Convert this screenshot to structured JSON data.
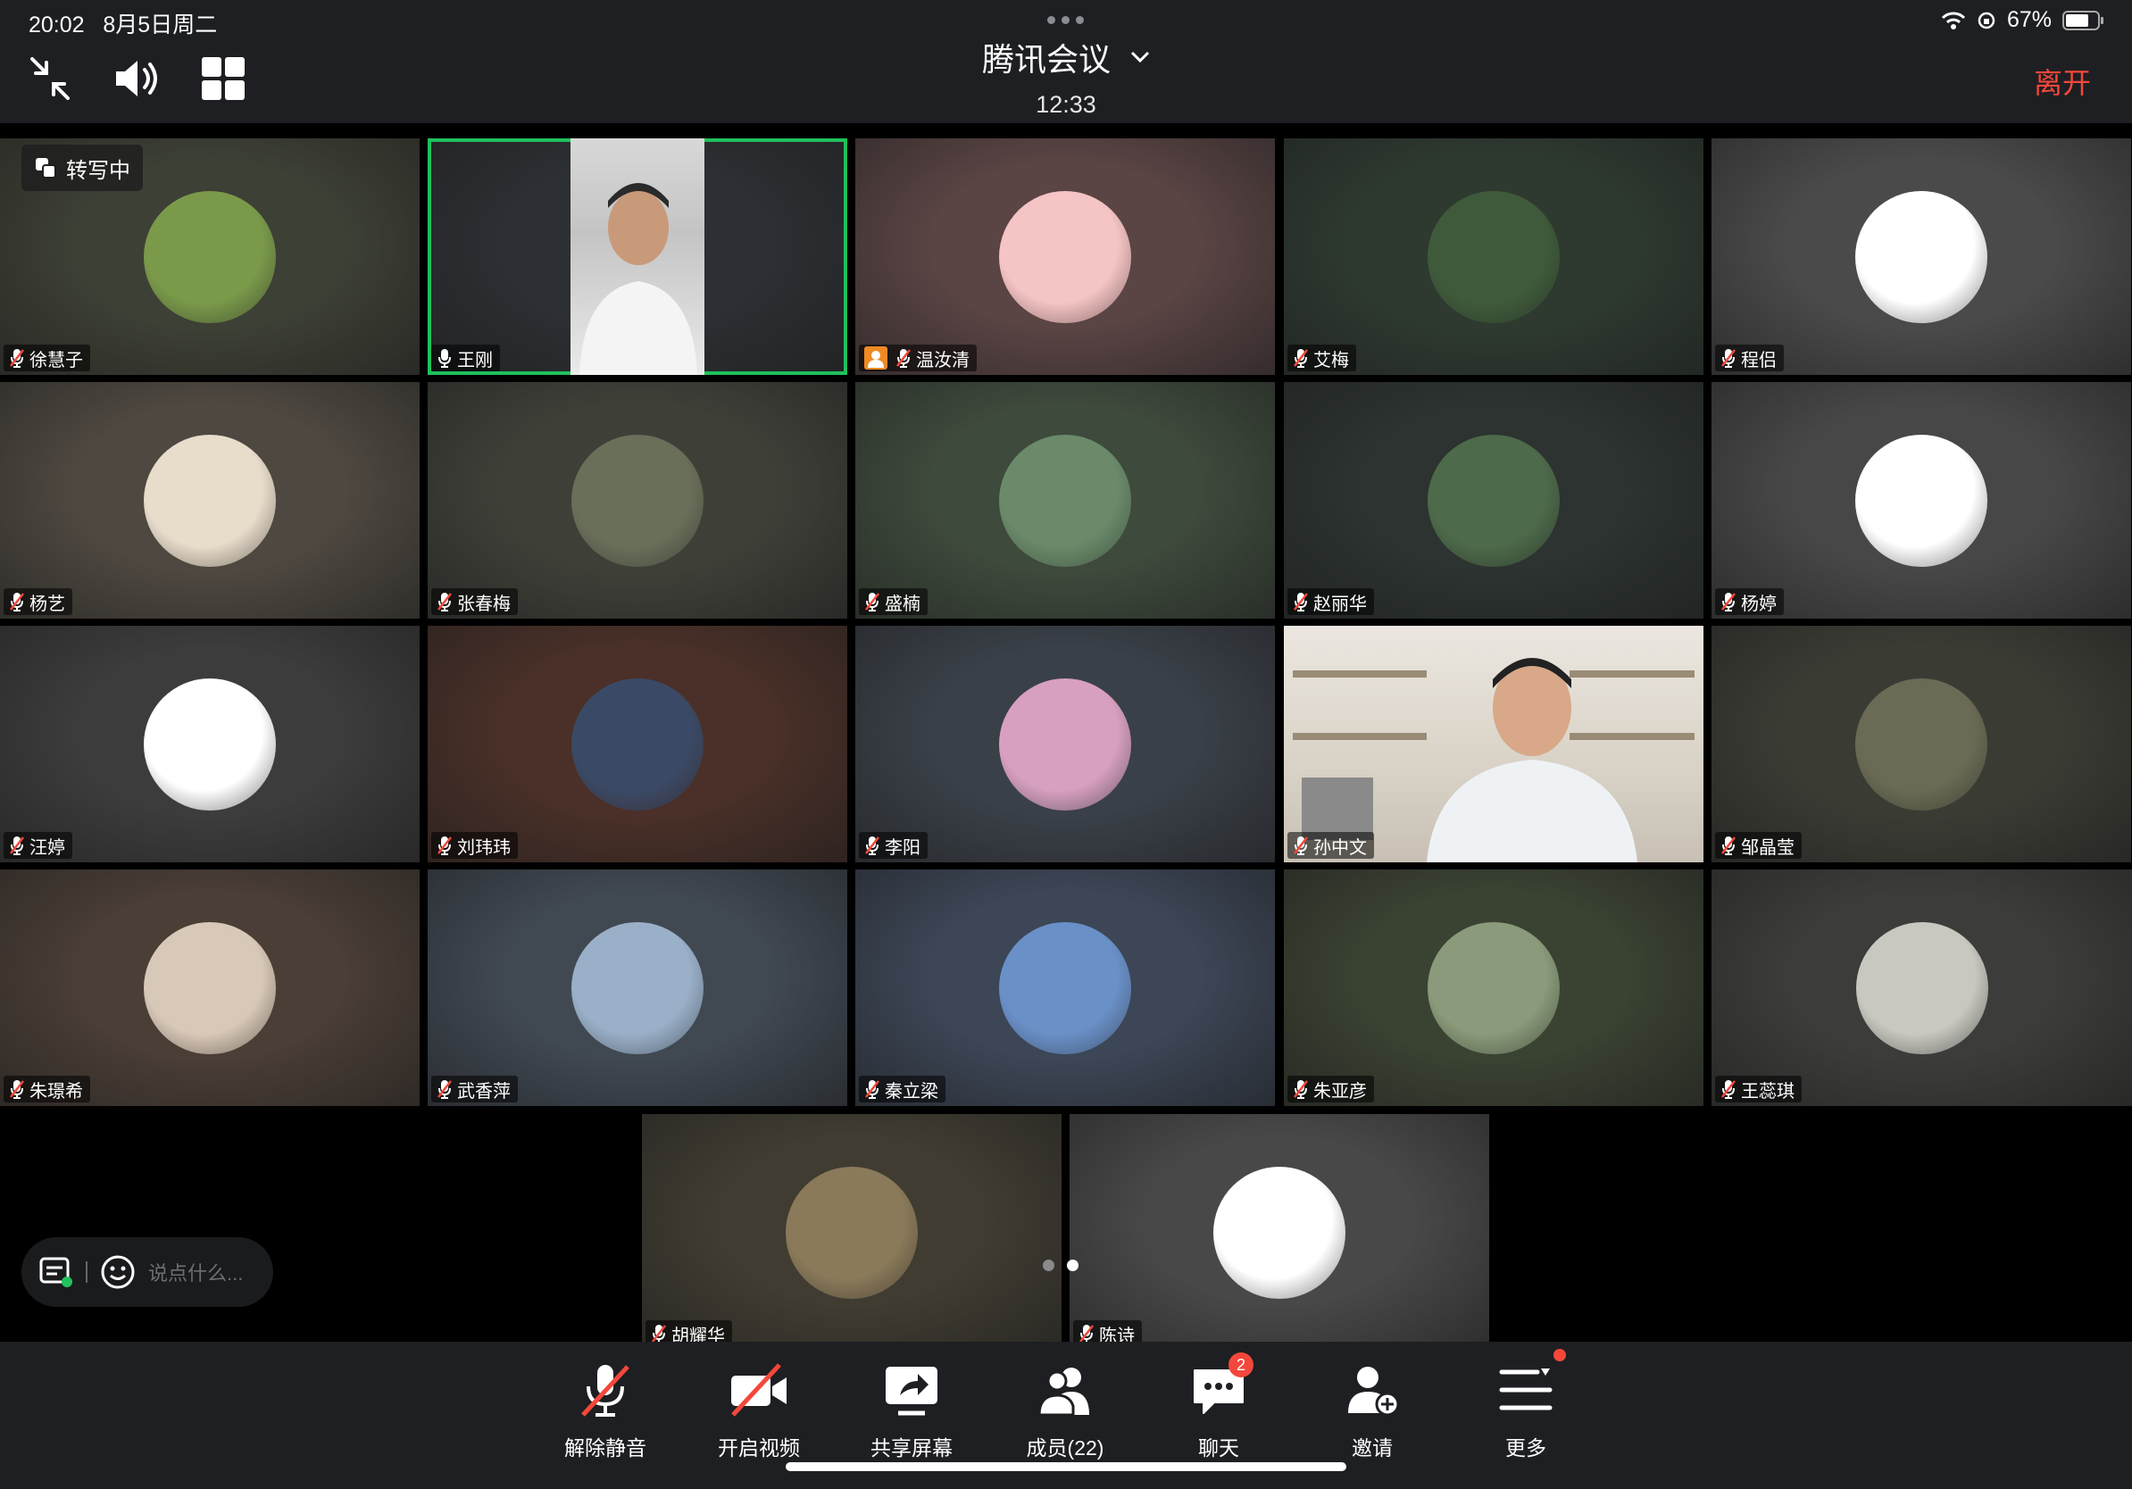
{
  "status_bar": {
    "time": "20:02",
    "date": "8月5日周二",
    "battery": "67%"
  },
  "header": {
    "title": "腾讯会议",
    "timer": "12:33",
    "leave_label": "离开"
  },
  "transcribe_label": "转写中",
  "chat_input": {
    "placeholder": "说点什么..."
  },
  "participants": [
    {
      "name": "徐慧子",
      "bg": "#3d4035",
      "avatar": "#7a9a4a"
    },
    {
      "name": "王刚",
      "bg": "#2c2f33",
      "avatar": "video",
      "active": true
    },
    {
      "name": "温汝清",
      "bg": "#5a4444",
      "avatar": "#f5c4c4",
      "host": true
    },
    {
      "name": "艾梅",
      "bg": "#2e3a30",
      "avatar": "#3f5a3a"
    },
    {
      "name": "程侣",
      "bg": "#4a4a4a",
      "avatar": "#ffffff"
    },
    {
      "name": "杨艺",
      "bg": "#4e4840",
      "avatar": "#e8dccb"
    },
    {
      "name": "张春梅",
      "bg": "#3e4038",
      "avatar": "#6a6f5a"
    },
    {
      "name": "盛楠",
      "bg": "#3e4a3c",
      "avatar": "#6a8a6a"
    },
    {
      "name": "赵丽华",
      "bg": "#2c3330",
      "avatar": "#4d6a4a"
    },
    {
      "name": "杨婷",
      "bg": "#474747",
      "avatar": "#ffffff"
    },
    {
      "name": "汪婷",
      "bg": "#3c3c3c",
      "avatar": "#ffffff"
    },
    {
      "name": "刘玮玮",
      "bg": "#4a3028",
      "avatar": "#3a4a66"
    },
    {
      "name": "李阳",
      "bg": "#3a4048",
      "avatar": "#d8a0c0"
    },
    {
      "name": "孙中文",
      "bg": "#cfc9c0",
      "avatar": "video"
    },
    {
      "name": "邹晶莹",
      "bg": "#3a3c34",
      "avatar": "#6a6a55"
    },
    {
      "name": "朱璟希",
      "bg": "#4a3e36",
      "avatar": "#d8c8b8"
    },
    {
      "name": "武香萍",
      "bg": "#404852",
      "avatar": "#9ab0c8"
    },
    {
      "name": "秦立梁",
      "bg": "#3c4656",
      "avatar": "#6a90c8"
    },
    {
      "name": "朱亚彦",
      "bg": "#3a4232",
      "avatar": "#8a9a7a"
    },
    {
      "name": "王蕊琪",
      "bg": "#3c3c3a",
      "avatar": "#c8c8c0"
    },
    {
      "name": "胡耀华",
      "bg": "#403c32",
      "avatar": "#8a7a5a"
    },
    {
      "name": "陈诗",
      "bg": "#484848",
      "avatar": "#ffffff"
    }
  ],
  "toolbar": {
    "unmute_label": "解除静音",
    "video_label": "开启视频",
    "share_label": "共享屏幕",
    "members_label": "成员(22)",
    "chat_label": "聊天",
    "chat_badge": "2",
    "invite_label": "邀请",
    "more_label": "更多"
  }
}
